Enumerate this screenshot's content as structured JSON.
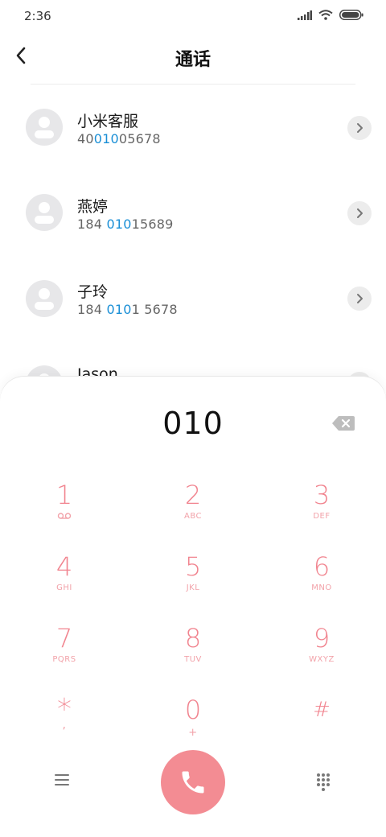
{
  "status_bar": {
    "time": "2:36"
  },
  "header": {
    "title": "通话"
  },
  "contacts": [
    {
      "name": "小米客服",
      "number_pre": "40",
      "number_match": "010",
      "number_post": "05678"
    },
    {
      "name": "燕婷",
      "number_pre": "184 ",
      "number_match": "010",
      "number_post": "15689"
    },
    {
      "name": "子玲",
      "number_pre": "184 ",
      "number_match": "010",
      "number_post": "1 5678"
    },
    {
      "name": "Jason",
      "number_pre": "",
      "number_match": "",
      "number_post": ""
    }
  ],
  "dialer": {
    "input": "010",
    "keys": [
      {
        "digit": "1",
        "letters": ""
      },
      {
        "digit": "2",
        "letters": "ABC"
      },
      {
        "digit": "3",
        "letters": "DEF"
      },
      {
        "digit": "4",
        "letters": "GHI"
      },
      {
        "digit": "5",
        "letters": "JKL"
      },
      {
        "digit": "6",
        "letters": "MNO"
      },
      {
        "digit": "7",
        "letters": "PQRS"
      },
      {
        "digit": "8",
        "letters": "TUV"
      },
      {
        "digit": "9",
        "letters": "WXYZ"
      },
      {
        "digit": "*",
        "letters": ","
      },
      {
        "digit": "0",
        "letters": "+"
      },
      {
        "digit": "#",
        "letters": ""
      }
    ]
  },
  "colors": {
    "accent": "#f38c93",
    "match": "#1a8fd6"
  },
  "icons": {
    "back": "chevron-left-icon",
    "voicemail": "voicemail-icon",
    "backspace": "backspace-icon",
    "menu": "menu-icon",
    "call": "phone-icon",
    "keypad": "dialpad-icon"
  }
}
